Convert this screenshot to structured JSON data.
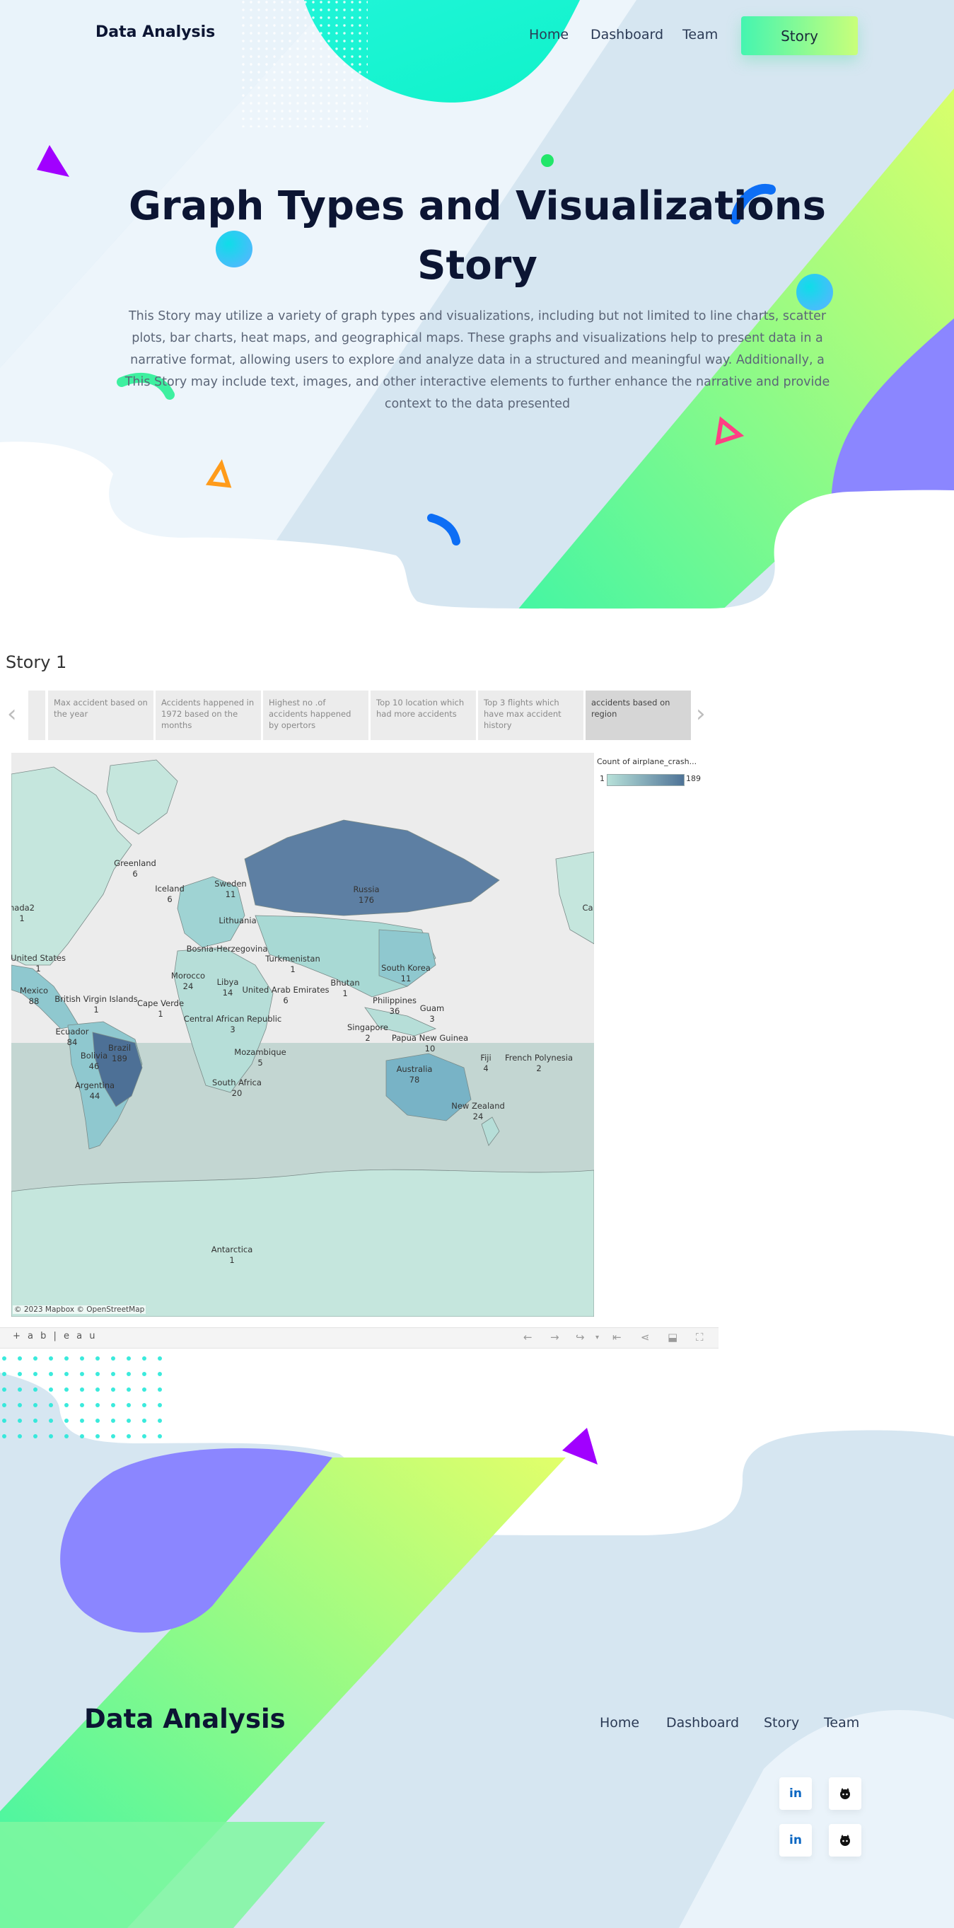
{
  "header": {
    "brand": "Data Analysis",
    "nav": [
      "Home",
      "Dashboard",
      "Team"
    ],
    "cta": "Story"
  },
  "hero": {
    "title": "Graph Types and Visualizations Story",
    "description": "This Story may utilize a variety of graph types and visualizations, including but not limited to line charts, scatter plots, bar charts, heat maps, and geographical maps. These graphs and visualizations help to present data in a narrative format, allowing users to explore and analyze data in a structured and meaningful way. Additionally, a This Story may include text, images, and other interactive elements to further enhance the narrative and provide context to the data presented"
  },
  "story": {
    "heading": "Story 1",
    "tabs": [
      "Max accident based on the year",
      "Accidents happened in 1972 based on the months",
      "Highest no .of accidents happened by opertors",
      "Top 10 location which had more accidents",
      "Top 3 flights which have max accident history",
      "accidents based on region"
    ],
    "active_tab": 5,
    "legend": {
      "title": "Count of airplane_crash...",
      "min": "1",
      "max": "189"
    },
    "map_labels": [
      {
        "name": "Greenland",
        "count": "6"
      },
      {
        "name": "Iceland",
        "count": "6"
      },
      {
        "name": "Sweden",
        "count": "11"
      },
      {
        "name": "Lithuania",
        "count": ""
      },
      {
        "name": "Russia",
        "count": "176"
      },
      {
        "name": "nada2",
        "count": "1"
      },
      {
        "name": "United States",
        "count": "1"
      },
      {
        "name": "Bosnia-Herzegovina",
        "count": ""
      },
      {
        "name": "Turkmenistan",
        "count": "1"
      },
      {
        "name": "South Korea",
        "count": "11"
      },
      {
        "name": "Morocco",
        "count": "24"
      },
      {
        "name": "Libya",
        "count": "14"
      },
      {
        "name": "United Arab Emirates",
        "count": "6"
      },
      {
        "name": "Bhutan",
        "count": "1"
      },
      {
        "name": "Mexico",
        "count": "88"
      },
      {
        "name": "British Virgin Islands",
        "count": "1"
      },
      {
        "name": "Cape Verde",
        "count": "1"
      },
      {
        "name": "Philippines",
        "count": "36"
      },
      {
        "name": "Guam",
        "count": "3"
      },
      {
        "name": "Central African Republic",
        "count": "3"
      },
      {
        "name": "Singapore",
        "count": "2"
      },
      {
        "name": "Papua New Guinea",
        "count": "10"
      },
      {
        "name": "Ecuador",
        "count": "84"
      },
      {
        "name": "Brazil",
        "count": "189"
      },
      {
        "name": "Bolivia",
        "count": "46"
      },
      {
        "name": "Mozambique",
        "count": "5"
      },
      {
        "name": "Fiji",
        "count": "4"
      },
      {
        "name": "French Polynesia",
        "count": "2"
      },
      {
        "name": "Australia",
        "count": "78"
      },
      {
        "name": "Argentina",
        "count": "44"
      },
      {
        "name": "South Africa",
        "count": "20"
      },
      {
        "name": "New Zealand",
        "count": "24"
      },
      {
        "name": "Antarctica",
        "count": "1"
      },
      {
        "name": "Ca",
        "count": ""
      }
    ],
    "credit": "© 2023 Mapbox  © OpenStreetMap",
    "tableau": "+ a b | e a u"
  },
  "footer": {
    "brand": "Data Analysis",
    "nav": [
      "Home",
      "Dashboard",
      "Story",
      "Team"
    ],
    "social": [
      "in",
      "github",
      "in",
      "github"
    ]
  },
  "colors": {
    "ink": "#0c1533",
    "accent_green": "#44f5b0",
    "accent_lime": "#c9ff7a",
    "violet": "#8b86ff",
    "sky": "#d7e7f2"
  }
}
